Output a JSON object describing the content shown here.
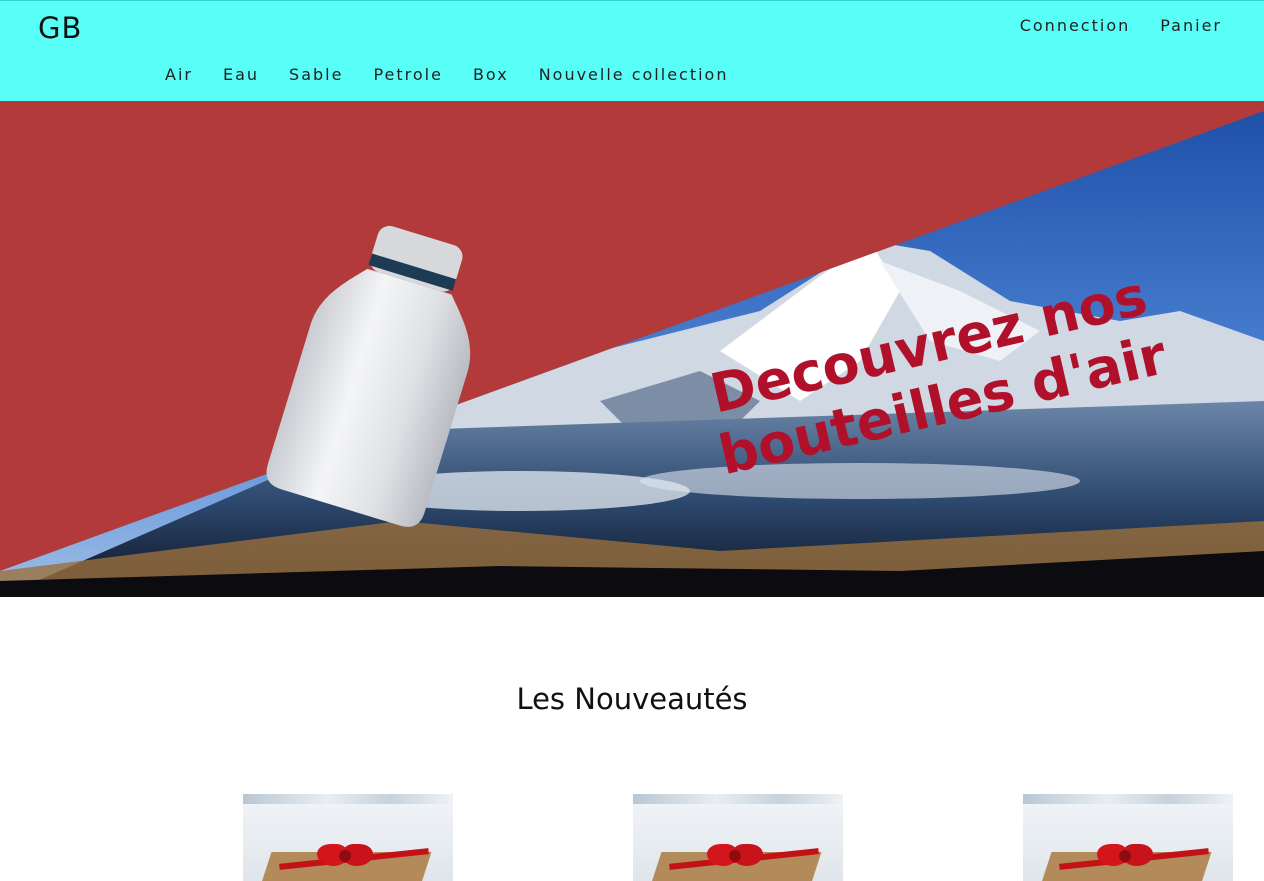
{
  "header": {
    "logo": "GB",
    "top_links": [
      "Connection",
      "Panier"
    ],
    "nav": [
      "Air",
      "Eau",
      "Sable",
      "Petrole",
      "Box",
      "Nouvelle collection"
    ]
  },
  "hero": {
    "line1": "Decouvrez nos",
    "line2": "bouteilles d'air"
  },
  "section": {
    "title": "Les Nouveautés"
  },
  "colors": {
    "header_bg": "#58fff7",
    "hero_red": "#b23a3a",
    "hero_text": "#b0102a"
  }
}
